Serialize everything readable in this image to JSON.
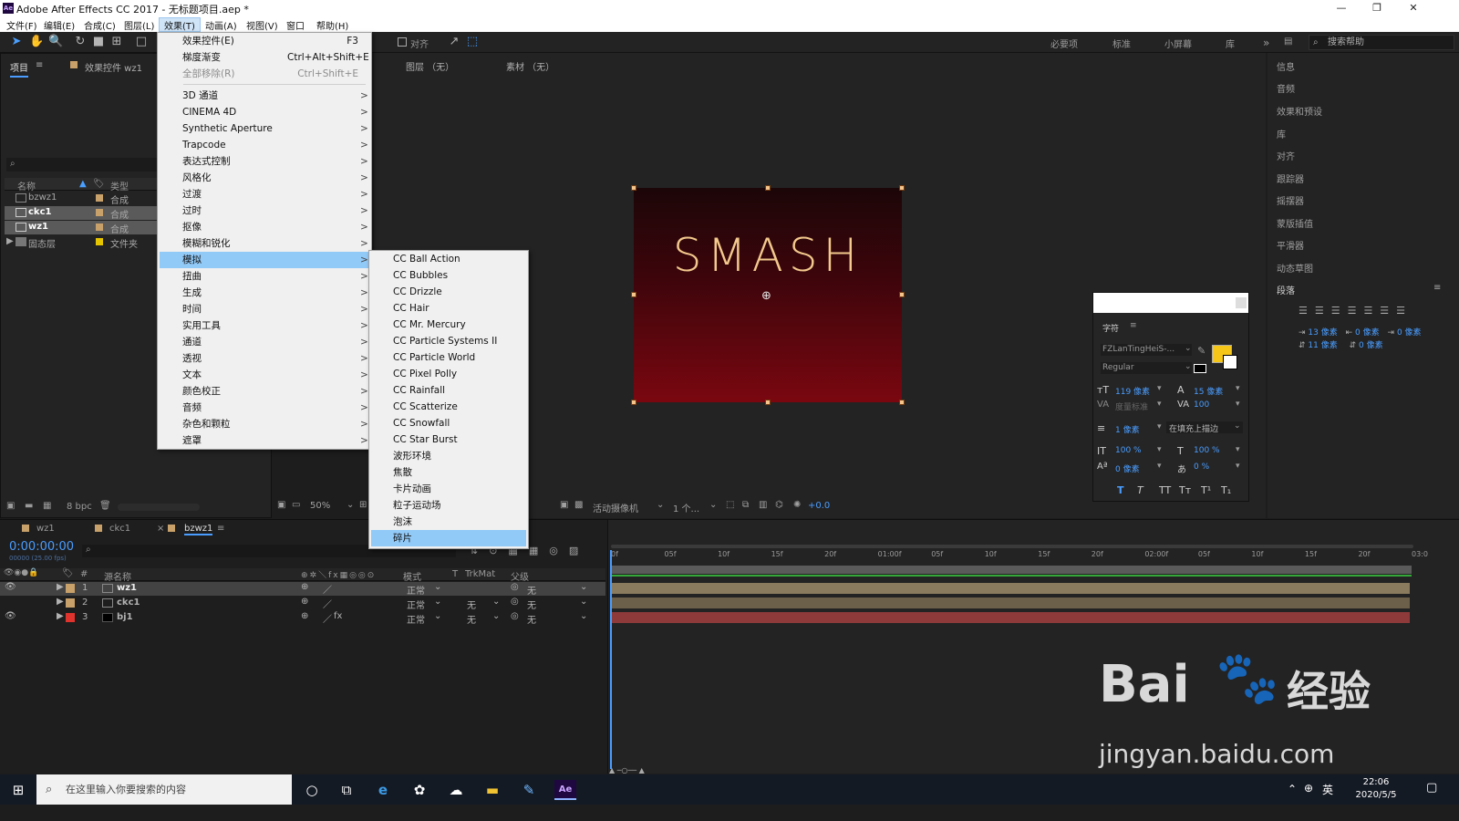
{
  "window": {
    "title": "Adobe After Effects CC 2017 - 无标题项目.aep *",
    "app_badge": "Ae"
  },
  "menubar": [
    "文件(F)",
    "编辑(E)",
    "合成(C)",
    "图层(L)",
    "效果(T)",
    "动画(A)",
    "视图(V)",
    "窗口",
    "帮助(H)"
  ],
  "toolbar": {
    "align_label": "对齐",
    "workspaces": [
      "必要项",
      "标准",
      "小屏幕",
      "库"
    ],
    "search_placeholder": "搜索帮助"
  },
  "project_panel": {
    "tabs": [
      "项目",
      "效果控件 wz1"
    ],
    "columns": [
      "名称",
      "类型"
    ],
    "items": [
      {
        "name": "bzwz1",
        "type": "合成"
      },
      {
        "name": "ckc1",
        "type": "合成"
      },
      {
        "name": "wz1",
        "type": "合成"
      },
      {
        "name": "固态层",
        "type": "文件夹"
      }
    ],
    "bpc": "8 bpc"
  },
  "effect_menu": {
    "items": [
      {
        "label": "效果控件(E)",
        "shortcut": "F3"
      },
      {
        "label": "梯度渐变",
        "shortcut": "Ctrl+Alt+Shift+E"
      },
      {
        "label": "全部移除(R)",
        "shortcut": "Ctrl+Shift+E",
        "disabled": true
      },
      {
        "label": "3D 通道"
      },
      {
        "label": "CINEMA 4D"
      },
      {
        "label": "Synthetic Aperture"
      },
      {
        "label": "Trapcode"
      },
      {
        "label": "表达式控制"
      },
      {
        "label": "风格化"
      },
      {
        "label": "过渡"
      },
      {
        "label": "过时"
      },
      {
        "label": "抠像"
      },
      {
        "label": "模糊和锐化"
      },
      {
        "label": "模拟",
        "highlighted": true
      },
      {
        "label": "扭曲"
      },
      {
        "label": "生成"
      },
      {
        "label": "时间"
      },
      {
        "label": "实用工具"
      },
      {
        "label": "通道"
      },
      {
        "label": "透视"
      },
      {
        "label": "文本"
      },
      {
        "label": "颜色校正"
      },
      {
        "label": "音频"
      },
      {
        "label": "杂色和颗粒"
      },
      {
        "label": "遮罩"
      }
    ],
    "arrow": ">"
  },
  "simulate_submenu": [
    "CC Ball Action",
    "CC Bubbles",
    "CC Drizzle",
    "CC Hair",
    "CC Mr. Mercury",
    "CC Particle Systems II",
    "CC Particle World",
    "CC Pixel Polly",
    "CC Rainfall",
    "CC Scatterize",
    "CC Snowfall",
    "CC Star Burst",
    "波形环境",
    "焦散",
    "卡片动画",
    "粒子运动场",
    "泡沫",
    "碎片"
  ],
  "viewer": {
    "header": [
      "图层 （无）",
      "素材 （无）"
    ],
    "comp_text": "SMASH",
    "zoom": "50%",
    "camera": "活动摄像机",
    "views": "1 个...",
    "exposure": "+0.0"
  },
  "right_panel": [
    "信息",
    "音频",
    "效果和预设",
    "库",
    "对齐",
    "跟踪器",
    "摇摆器",
    "蒙版插值",
    "平滑器",
    "动态草图",
    "段落"
  ],
  "paragraph_values": [
    "13 像素",
    "0 像素",
    "0 像素",
    "11 像素",
    "0 像素"
  ],
  "character_panel": {
    "title": "字符",
    "font": "FZLanTingHeiS-...",
    "style": "Regular",
    "size": "119 像素",
    "leading": "15 像素",
    "kerning": "度量标准",
    "tracking": "100",
    "stroke": "1 像素",
    "stroke_mode": "在填充上描边",
    "vscale": "100 %",
    "hscale": "100 %",
    "baseline": "0 像素",
    "tsume": "0 %",
    "fill_color": "#f5c518",
    "text_styles": [
      "T",
      "T",
      "TT",
      "Tт",
      "T¹",
      "T₁"
    ]
  },
  "timeline": {
    "tabs": [
      "wz1",
      "ckc1",
      "bzwz1"
    ],
    "timecode": "0:00:00:00",
    "fps": "00000 (25.00 fps)",
    "columns": [
      "源名称",
      "模式",
      "T",
      "TrkMat",
      "父级"
    ],
    "layers": [
      {
        "num": "1",
        "name": "wz1",
        "mode": "正常",
        "trkmat": "",
        "parent": "无",
        "color": "#c8a06a"
      },
      {
        "num": "2",
        "name": "ckc1",
        "mode": "正常",
        "trkmat": "无",
        "parent": "无",
        "color": "#c8a06a"
      },
      {
        "num": "3",
        "name": "bj1",
        "mode": "正常",
        "trkmat": "无",
        "parent": "无",
        "color": "#e0332e"
      }
    ],
    "ruler": [
      "0f",
      "05f",
      "10f",
      "15f",
      "20f",
      "01:00f",
      "05f",
      "10f",
      "15f",
      "20f",
      "02:00f",
      "05f",
      "10f",
      "15f",
      "20f",
      "03:0"
    ]
  },
  "taskbar": {
    "search_placeholder": "在这里输入你要搜索的内容",
    "tray_lang": "英",
    "time": "22:06",
    "date": "2020/5/5"
  },
  "watermark": {
    "brand": "Bai",
    "suffix": "经验",
    "url": "jingyan.baidu.com"
  }
}
